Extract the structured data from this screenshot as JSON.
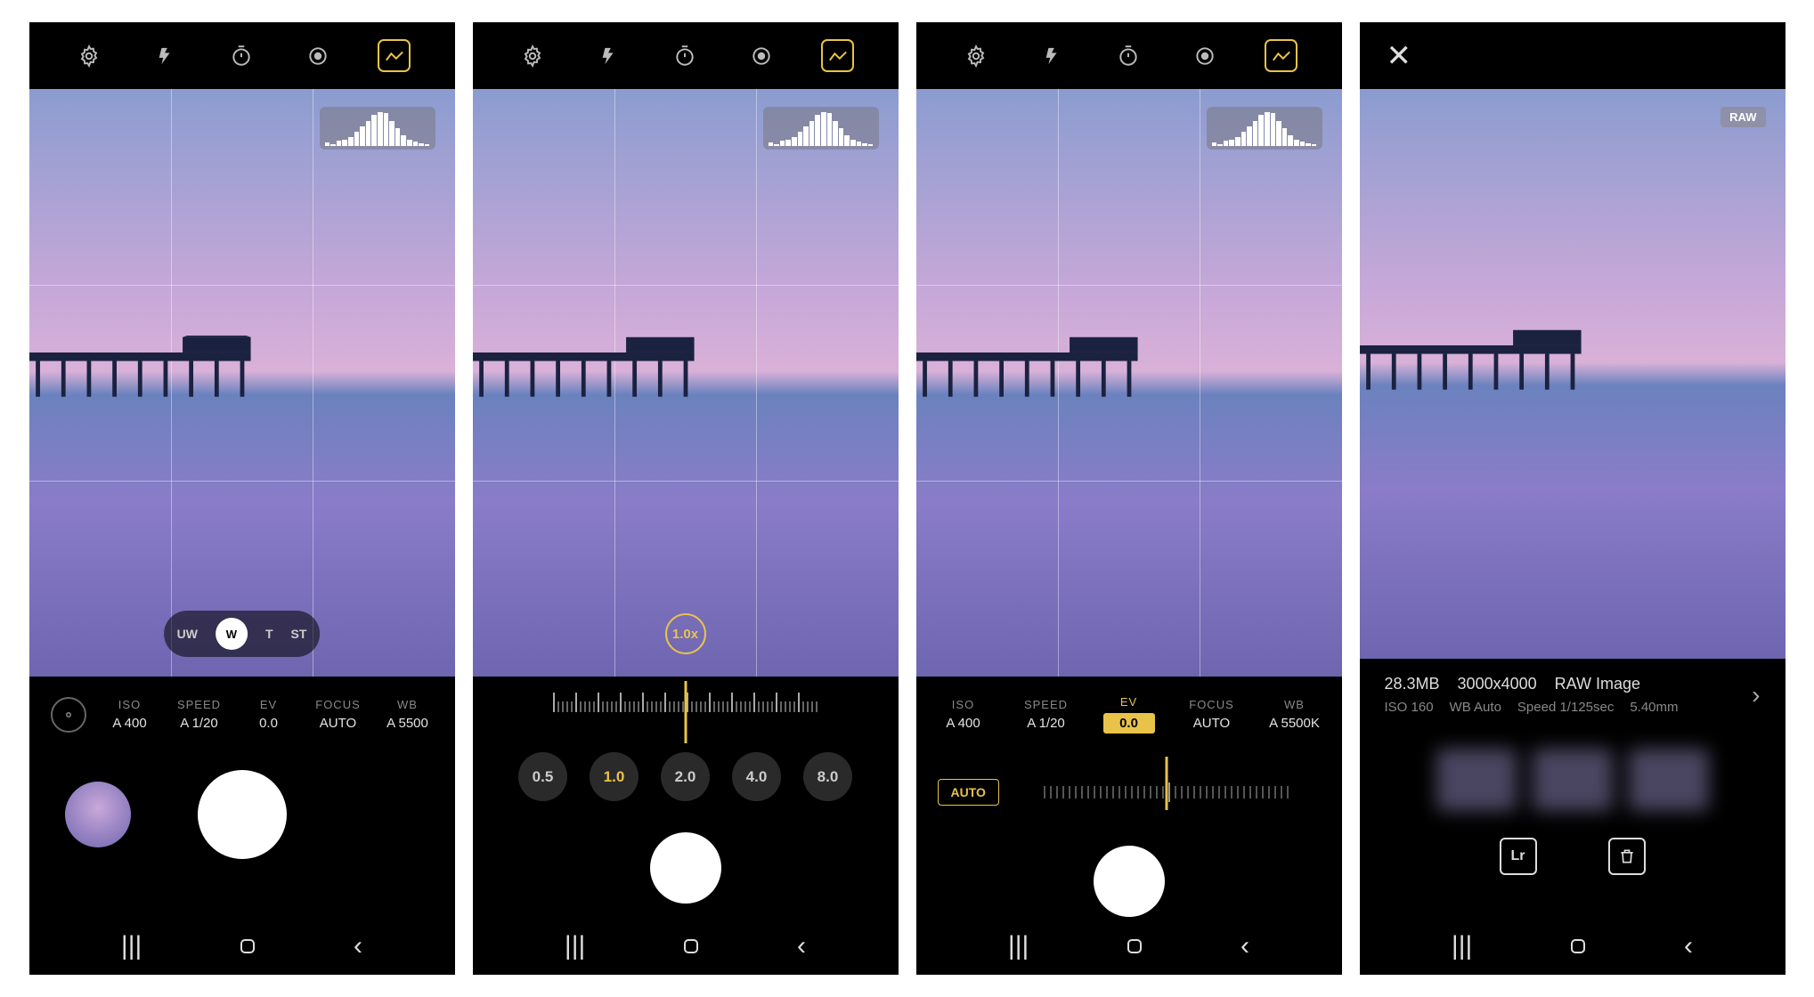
{
  "screens": [
    {
      "topbar_icons": [
        "settings",
        "flash",
        "timer",
        "metering",
        "level"
      ],
      "histogram": [
        10,
        6,
        14,
        18,
        25,
        40,
        55,
        70,
        88,
        95,
        92,
        70,
        50,
        30,
        18,
        12,
        8,
        6
      ],
      "lens_options": [
        "UW",
        "W",
        "T",
        "ST"
      ],
      "lens_selected": "W",
      "params": {
        "iso": {
          "label": "ISO",
          "value": "A 400"
        },
        "speed": {
          "label": "SPEED",
          "value": "A 1/20"
        },
        "ev": {
          "label": "EV",
          "value": "0.0"
        },
        "focus": {
          "label": "FOCUS",
          "value": "AUTO"
        },
        "wb": {
          "label": "WB",
          "value": "A 5500"
        }
      }
    },
    {
      "topbar_icons": [
        "settings",
        "flash",
        "timer",
        "metering",
        "level"
      ],
      "histogram": [
        10,
        6,
        14,
        18,
        25,
        40,
        55,
        70,
        88,
        95,
        92,
        70,
        50,
        30,
        18,
        12,
        8,
        6
      ],
      "zoom_current": "1.0x",
      "zoom_presets": [
        "0.5",
        "1.0",
        "2.0",
        "4.0",
        "8.0"
      ],
      "zoom_selected": "1.0"
    },
    {
      "topbar_icons": [
        "settings",
        "flash",
        "timer",
        "metering",
        "level"
      ],
      "histogram": [
        10,
        6,
        14,
        18,
        25,
        40,
        55,
        70,
        88,
        95,
        92,
        70,
        50,
        30,
        18,
        12,
        8,
        6
      ],
      "params": {
        "iso": {
          "label": "ISO",
          "value": "A 400"
        },
        "speed": {
          "label": "SPEED",
          "value": "A 1/20"
        },
        "ev": {
          "label": "EV",
          "value": "0.0"
        },
        "focus": {
          "label": "FOCUS",
          "value": "AUTO"
        },
        "wb": {
          "label": "WB",
          "value": "A 5500K"
        }
      },
      "ev_auto": "AUTO"
    },
    {
      "raw_badge": "RAW",
      "meta": {
        "size": "28.3MB",
        "dimensions": "3000x4000",
        "type": "RAW Image",
        "iso": "ISO 160",
        "wb": "WB Auto",
        "speed": "Speed 1/125sec",
        "focal": "5.40mm"
      },
      "actions": [
        "Lr",
        "delete"
      ]
    }
  ],
  "nav": {
    "recents": "|||",
    "home": "◯",
    "back": "‹"
  }
}
